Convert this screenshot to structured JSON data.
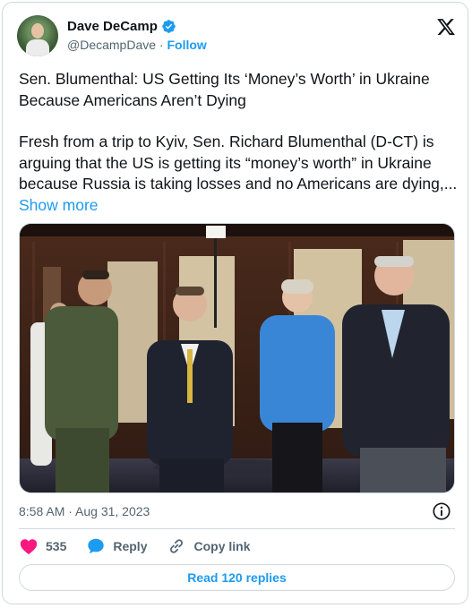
{
  "author": {
    "name": "Dave DeCamp",
    "handle": "@DecampDave",
    "separator": "·",
    "follow_label": "Follow"
  },
  "tweet": {
    "headline": "Sen. Blumenthal: US Getting Its ‘Money’s Worth’ in Ukraine Because Americans Aren’t Dying",
    "body": "Fresh from a trip to Kyiv, Sen. Richard Blumenthal (D-CT) is arguing that the US is getting its “money’s worth” in Ukraine because Russia is taking losses and no Americans are dying,...",
    "show_more": "Show more"
  },
  "meta": {
    "timestamp": "8:58 AM · Aug 31, 2023"
  },
  "actions": {
    "likes_count": "535",
    "reply_label": "Reply",
    "copy_link_label": "Copy link",
    "read_replies_label": "Read 120 replies"
  },
  "colors": {
    "accent": "#1d9bf0",
    "like": "#f91880",
    "text": "#0f1419",
    "muted": "#536471",
    "border": "#cfd9de"
  },
  "icons": {
    "verified": "verified-badge-icon",
    "x_logo": "x-logo-icon",
    "info": "info-icon",
    "like": "heart-icon",
    "reply": "speech-bubble-icon",
    "copy_link": "link-icon"
  }
}
